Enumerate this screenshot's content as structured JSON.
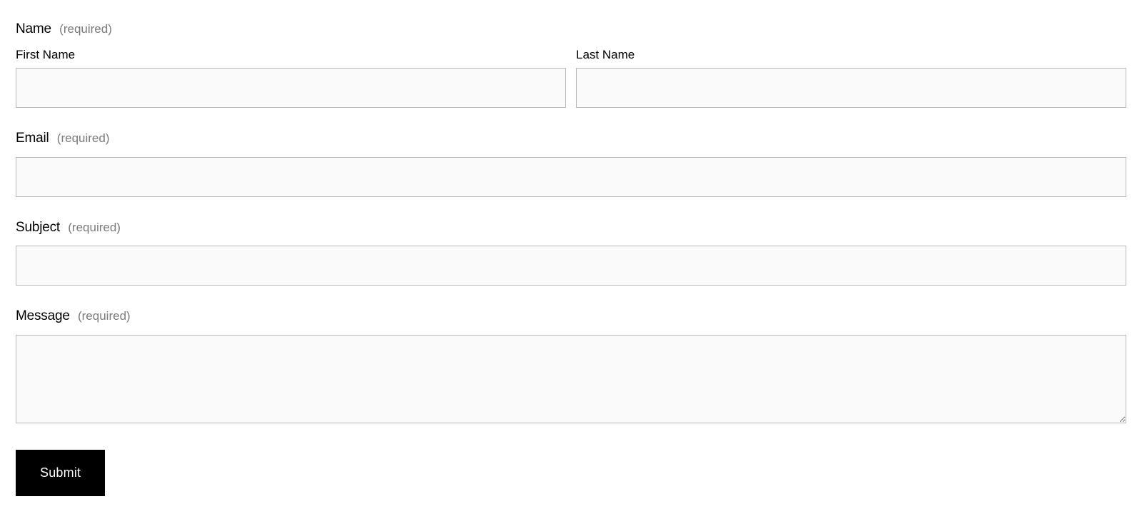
{
  "form": {
    "name": {
      "label": "Name",
      "hint": "(required)",
      "first": {
        "label": "First Name",
        "value": ""
      },
      "last": {
        "label": "Last Name",
        "value": ""
      }
    },
    "email": {
      "label": "Email",
      "hint": "(required)",
      "value": ""
    },
    "subject": {
      "label": "Subject",
      "hint": "(required)",
      "value": ""
    },
    "message": {
      "label": "Message",
      "hint": "(required)",
      "value": ""
    },
    "submit_label": "Submit"
  }
}
